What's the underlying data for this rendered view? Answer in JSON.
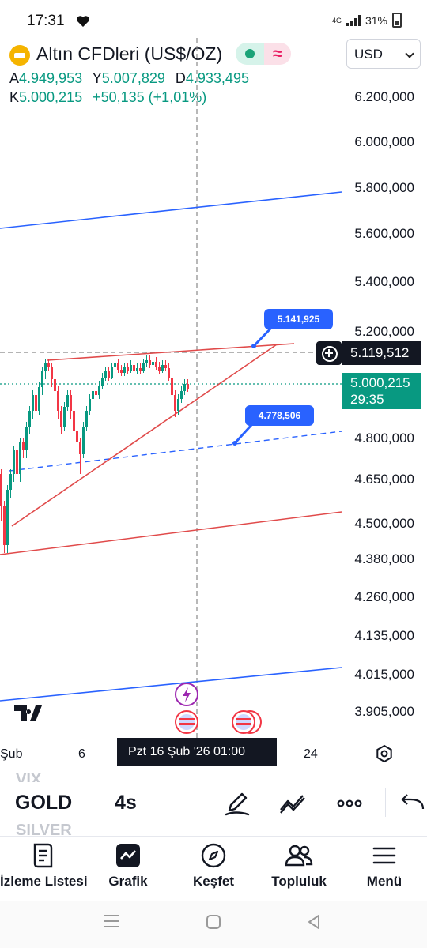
{
  "status_bar": {
    "time": "17:31",
    "battery": "31%",
    "network": "4G"
  },
  "header": {
    "symbol_title": "Altın CFDleri (US$/OZ)",
    "currency": "USD",
    "ohlc": {
      "open_key": "A",
      "open": "4.949,953",
      "high_key": "Y",
      "high": "5.007,829",
      "low_key": "D",
      "low": "4.933,495",
      "close_key": "K",
      "close": "5.000,215",
      "change": "+50,135 (+1,01%)"
    }
  },
  "chart": {
    "price_axis": [
      "6.200,000",
      "6.000,000",
      "5.800,000",
      "5.600,000",
      "5.400,000",
      "5.200,000",
      "4.800,000",
      "4.650,000",
      "4.500,000",
      "4.380,000",
      "4.260,000",
      "4.135,000",
      "4.015,000",
      "3.905,000"
    ],
    "crosshair_price": "5.119,512",
    "last_price": "5.000,215",
    "countdown": "29:35",
    "callout_upper": "5.141,925",
    "callout_lower": "4.778,506",
    "date_labels": [
      "Şub",
      "6",
      "24"
    ],
    "date_cursor": "Pzt 16 Şub '26   01:00",
    "colors": {
      "up": "#089981",
      "down": "#f23645",
      "trend_red": "#e04a4a",
      "trend_blue": "#2962ff",
      "accent_purple": "#9c27b0"
    }
  },
  "toolbar": {
    "prev_symbol": "VIX",
    "current_symbol": "GOLD",
    "next_symbol": "SILVER",
    "interval": "4s"
  },
  "bottom_nav": [
    {
      "label": "İzleme Listesi",
      "icon": "watchlist-icon"
    },
    {
      "label": "Grafik",
      "icon": "chart-icon"
    },
    {
      "label": "Keşfet",
      "icon": "compass-icon"
    },
    {
      "label": "Topluluk",
      "icon": "community-icon"
    },
    {
      "label": "Menü",
      "icon": "menu-icon"
    }
  ]
}
